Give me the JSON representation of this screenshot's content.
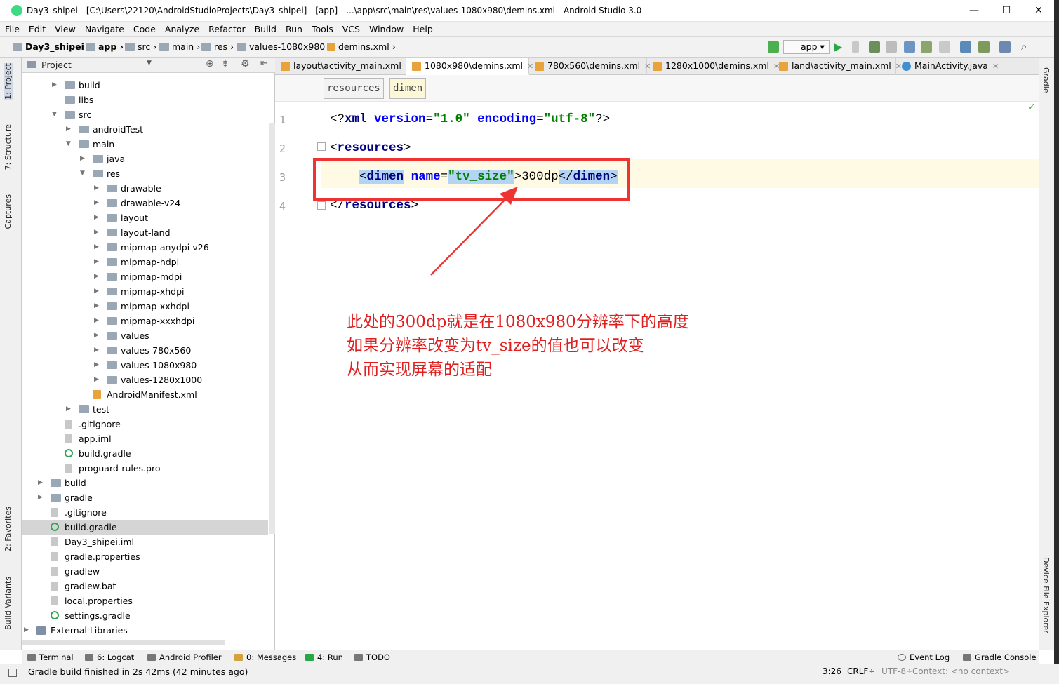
{
  "window": {
    "title": "Day3_shipei - [C:\\Users\\22120\\AndroidStudioProjects\\Day3_shipei] - [app] - ...\\app\\src\\main\\res\\values-1080x980\\demins.xml - Android Studio 3.0",
    "minimize": "—",
    "maximize": "☐",
    "close": "✕"
  },
  "menu": [
    "File",
    "Edit",
    "View",
    "Navigate",
    "Code",
    "Analyze",
    "Refactor",
    "Build",
    "Run",
    "Tools",
    "VCS",
    "Window",
    "Help"
  ],
  "breadcrumbs": [
    "Day3_shipei",
    "app",
    "src",
    "main",
    "res",
    "values-1080x980",
    "demins.xml"
  ],
  "toolbar": {
    "run_config": "app"
  },
  "left_tool_tabs": [
    "1: Project",
    "7: Structure",
    "Captures",
    "2: Favorites",
    "Build Variants"
  ],
  "right_tool_tabs": [
    "Gradle",
    "Device File Explorer"
  ],
  "project_panel": {
    "header": "Project",
    "tree": [
      {
        "label": "build",
        "depth": 2,
        "kind": "folder",
        "arrow": "▶"
      },
      {
        "label": "libs",
        "depth": 2,
        "kind": "folder",
        "arrow": ""
      },
      {
        "label": "src",
        "depth": 2,
        "kind": "folder",
        "arrow": "▼"
      },
      {
        "label": "androidTest",
        "depth": 3,
        "kind": "folder",
        "arrow": "▶"
      },
      {
        "label": "main",
        "depth": 3,
        "kind": "folder",
        "arrow": "▼"
      },
      {
        "label": "java",
        "depth": 4,
        "kind": "folder",
        "arrow": "▶"
      },
      {
        "label": "res",
        "depth": 4,
        "kind": "folder",
        "arrow": "▼"
      },
      {
        "label": "drawable",
        "depth": 5,
        "kind": "folder",
        "arrow": "▶"
      },
      {
        "label": "drawable-v24",
        "depth": 5,
        "kind": "folder",
        "arrow": "▶"
      },
      {
        "label": "layout",
        "depth": 5,
        "kind": "folder",
        "arrow": "▶"
      },
      {
        "label": "layout-land",
        "depth": 5,
        "kind": "folder",
        "arrow": "▶"
      },
      {
        "label": "mipmap-anydpi-v26",
        "depth": 5,
        "kind": "folder",
        "arrow": "▶"
      },
      {
        "label": "mipmap-hdpi",
        "depth": 5,
        "kind": "folder",
        "arrow": "▶"
      },
      {
        "label": "mipmap-mdpi",
        "depth": 5,
        "kind": "folder",
        "arrow": "▶"
      },
      {
        "label": "mipmap-xhdpi",
        "depth": 5,
        "kind": "folder",
        "arrow": "▶"
      },
      {
        "label": "mipmap-xxhdpi",
        "depth": 5,
        "kind": "folder",
        "arrow": "▶"
      },
      {
        "label": "mipmap-xxxhdpi",
        "depth": 5,
        "kind": "folder",
        "arrow": "▶"
      },
      {
        "label": "values",
        "depth": 5,
        "kind": "folder",
        "arrow": "▶"
      },
      {
        "label": "values-780x560",
        "depth": 5,
        "kind": "folder",
        "arrow": "▶"
      },
      {
        "label": "values-1080x980",
        "depth": 5,
        "kind": "folder",
        "arrow": "▶"
      },
      {
        "label": "values-1280x1000",
        "depth": 5,
        "kind": "folder",
        "arrow": "▶"
      },
      {
        "label": "AndroidManifest.xml",
        "depth": 4,
        "kind": "xml",
        "arrow": ""
      },
      {
        "label": "test",
        "depth": 3,
        "kind": "folder",
        "arrow": "▶"
      },
      {
        "label": ".gitignore",
        "depth": 2,
        "kind": "file",
        "arrow": ""
      },
      {
        "label": "app.iml",
        "depth": 2,
        "kind": "file",
        "arrow": ""
      },
      {
        "label": "build.gradle",
        "depth": 2,
        "kind": "gradle",
        "arrow": ""
      },
      {
        "label": "proguard-rules.pro",
        "depth": 2,
        "kind": "file",
        "arrow": ""
      },
      {
        "label": "build",
        "depth": 1,
        "kind": "folder",
        "arrow": "▶"
      },
      {
        "label": "gradle",
        "depth": 1,
        "kind": "folder",
        "arrow": "▶"
      },
      {
        "label": ".gitignore",
        "depth": 1,
        "kind": "file",
        "arrow": ""
      },
      {
        "label": "build.gradle",
        "depth": 1,
        "kind": "gradle",
        "arrow": "",
        "selected": true
      },
      {
        "label": "Day3_shipei.iml",
        "depth": 1,
        "kind": "file",
        "arrow": ""
      },
      {
        "label": "gradle.properties",
        "depth": 1,
        "kind": "file",
        "arrow": ""
      },
      {
        "label": "gradlew",
        "depth": 1,
        "kind": "file",
        "arrow": ""
      },
      {
        "label": "gradlew.bat",
        "depth": 1,
        "kind": "file",
        "arrow": ""
      },
      {
        "label": "local.properties",
        "depth": 1,
        "kind": "file",
        "arrow": ""
      },
      {
        "label": "settings.gradle",
        "depth": 1,
        "kind": "gradle",
        "arrow": ""
      },
      {
        "label": "External Libraries",
        "depth": 0,
        "kind": "lib",
        "arrow": "▶"
      }
    ]
  },
  "editor_tabs": [
    {
      "label": "layout\\activity_main.xml",
      "kind": "xml"
    },
    {
      "label": "1080x980\\demins.xml",
      "kind": "xml",
      "active": true
    },
    {
      "label": "780x560\\demins.xml",
      "kind": "xml"
    },
    {
      "label": "1280x1000\\demins.xml",
      "kind": "xml"
    },
    {
      "label": "land\\activity_main.xml",
      "kind": "xml"
    },
    {
      "label": "MainActivity.java",
      "kind": "java"
    }
  ],
  "xml_breadcrumb": [
    "resources",
    "dimen"
  ],
  "code": {
    "line_numbers": [
      "1",
      "2",
      "3",
      "4"
    ],
    "l1": {
      "open": "<?",
      "tag": "xml",
      "a1": "version",
      "eq1": "=",
      "v1": "\"1.0\"",
      "a2": "encoding",
      "eq2": "=",
      "v2": "\"utf-8\"",
      "close": "?>"
    },
    "l2": {
      "open": "<",
      "tag": "resources",
      "close": ">"
    },
    "l3": {
      "open": "<",
      "tag": "dimen",
      "attr": "name",
      "eq": "=",
      "val": "\"tv_size\"",
      "close": ">",
      "text": "300dp",
      "end_open": "</",
      "end_tag": "dimen",
      "end_close": ">"
    },
    "l4": {
      "open": "</",
      "tag": "resources",
      "close": ">"
    }
  },
  "annotation": {
    "lines": [
      "此处的300dp就是在1080x980分辨率下的高度",
      "如果分辨率改变为tv_size的值也可以改变",
      "从而实现屏幕的适配"
    ],
    "color": "#e02020"
  },
  "tool_windows": [
    "Terminal",
    "6: Logcat",
    "Android Profiler",
    "0: Messages",
    "4: Run",
    "TODO",
    "Event Log",
    "Gradle Console"
  ],
  "status": {
    "message": "Gradle build finished in 2s 42ms (42 minutes ago)",
    "position": "3:26",
    "line_sep": "CRLF÷",
    "encoding": "UTF-8÷",
    "context": "Context: <no context>"
  }
}
